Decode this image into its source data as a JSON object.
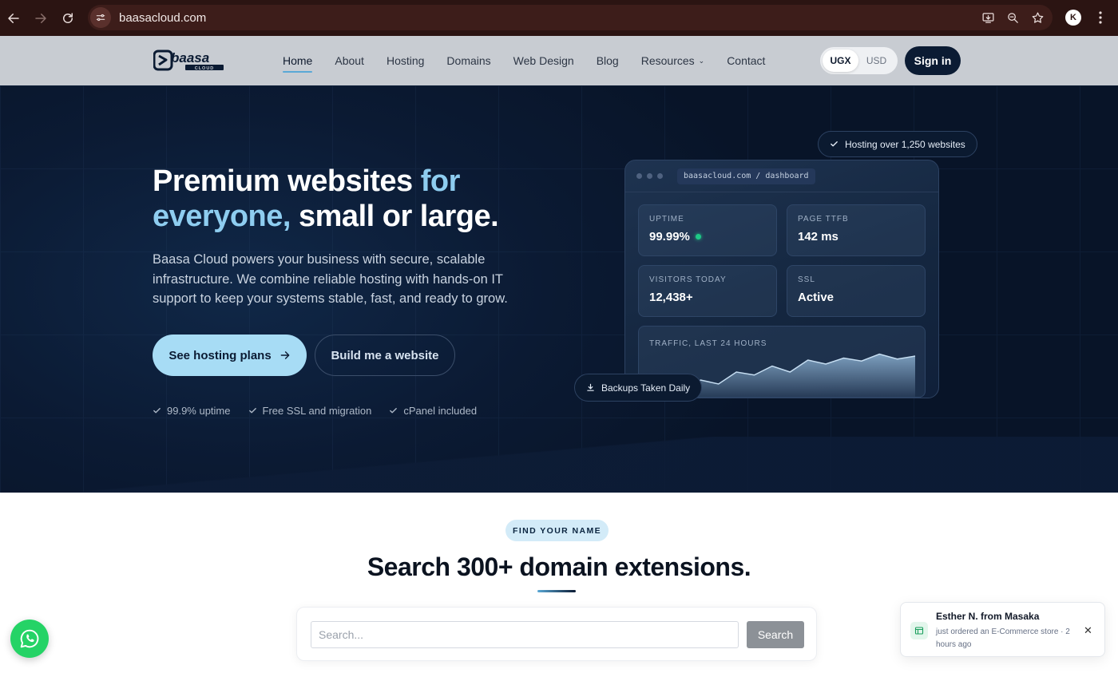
{
  "browser": {
    "url": "baasacloud.com",
    "profile_initial": "K"
  },
  "header": {
    "logo_text": "baasa",
    "logo_subtext": "CLOUD",
    "nav": [
      "Home",
      "About",
      "Hosting",
      "Domains",
      "Web Design",
      "Blog",
      "Resources",
      "Contact"
    ],
    "active_nav": "Home",
    "currency_options": [
      "UGX",
      "USD"
    ],
    "selected_currency": "UGX",
    "signin_label": "Sign in"
  },
  "hero": {
    "title_part1": "Premium websites ",
    "title_highlight": "for everyone,",
    "title_part2": " small or large.",
    "subtitle": "Baasa Cloud powers your business with secure, scalable infrastructure. We combine reliable hosting with hands-on IT support to keep your systems stable, fast, and ready to grow.",
    "primary_cta": "See hosting plans",
    "secondary_cta": "Build me a website",
    "checks": [
      "99.9% uptime",
      "Free SSL and migration",
      "cPanel included"
    ]
  },
  "dashboard": {
    "url": "baasacloud.com / dashboard",
    "stats": [
      {
        "label": "UPTIME",
        "value": "99.99%"
      },
      {
        "label": "PAGE TTFB",
        "value": "142 ms"
      },
      {
        "label": "VISITORS TODAY",
        "value": "12,438+"
      },
      {
        "label": "SSL",
        "value": "Active"
      }
    ],
    "traffic_label": "TRAFFIC, LAST 24 HOURS",
    "traffic_series": [
      2,
      12,
      8,
      20,
      17,
      26,
      20,
      32,
      28,
      34,
      31,
      38,
      33,
      36
    ],
    "badge_top": "Hosting over 1,250 websites",
    "badge_bottom": "Backups Taken Daily",
    "status_color": "#1ec986"
  },
  "domains": {
    "pill": "FIND YOUR NAME",
    "title": "Search 300+ domain extensions.",
    "search_placeholder": "Search...",
    "search_button": "Search"
  },
  "toast": {
    "name": "Esther N. from Masaka",
    "message": "just ordered an E-Commerce store · 2 hours ago"
  },
  "colors": {
    "accent": "#8ecdf0",
    "brand_dark": "#0b1b33",
    "whatsapp": "#25d366"
  }
}
